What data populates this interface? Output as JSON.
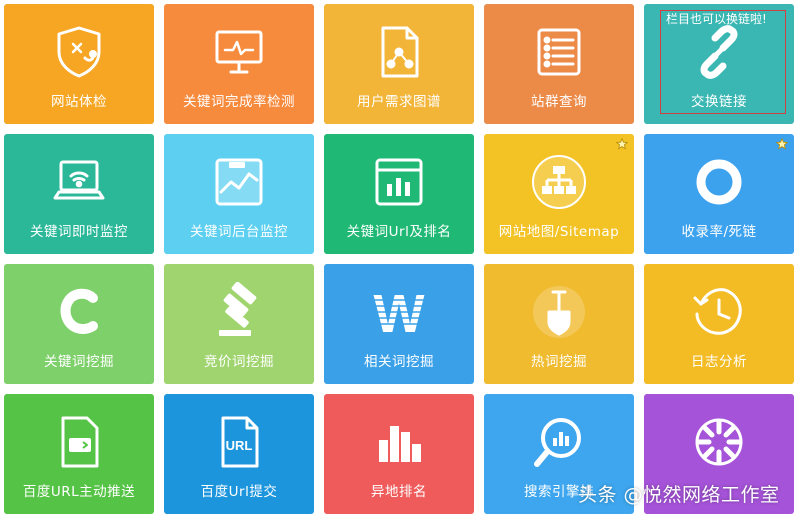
{
  "tiles": [
    {
      "label": "网站体检",
      "icon": "shield-stethoscope-icon",
      "color": "#f6a623"
    },
    {
      "label": "关键词完成率检测",
      "icon": "monitor-pulse-icon",
      "color": "#f68b3e"
    },
    {
      "label": "用户需求图谱",
      "icon": "document-graph-icon",
      "color": "#f2b538"
    },
    {
      "label": "站群查询",
      "icon": "list-icon",
      "color": "#ec8a48"
    },
    {
      "label": "交换链接",
      "icon": "chain-link-icon",
      "color": "#3ab7b3"
    },
    {
      "label": "关键词即时监控",
      "icon": "laptop-wifi-icon",
      "color": "#2bb899"
    },
    {
      "label": "关键词后台监控",
      "icon": "chart-trend-icon",
      "color": "#5dcff0"
    },
    {
      "label": "关键词Url及排名",
      "icon": "bar-chart-window-icon",
      "color": "#1fb874"
    },
    {
      "label": "网站地图/Sitemap",
      "icon": "sitemap-icon",
      "color": "#f3c224"
    },
    {
      "label": "收录率/死链",
      "icon": "ring-icon",
      "color": "#3ca2ee"
    },
    {
      "label": "关键词挖掘",
      "icon": "letter-c-icon",
      "color": "#7ed06a"
    },
    {
      "label": "竞价词挖掘",
      "icon": "gavel-icon",
      "color": "#9fd46e"
    },
    {
      "label": "相关词挖掘",
      "icon": "letter-w-icon",
      "color": "#3aa0e8"
    },
    {
      "label": "热词挖掘",
      "icon": "shovel-icon",
      "color": "#f0bb2f"
    },
    {
      "label": "日志分析",
      "icon": "clock-icon",
      "color": "#f3bb24"
    },
    {
      "label": "百度URL主动推送",
      "icon": "push-arrow-icon",
      "color": "#55c345"
    },
    {
      "label": "百度Url提交",
      "icon": "url-document-icon",
      "color": "#1d95dd"
    },
    {
      "label": "异地排名",
      "icon": "bars-icon",
      "color": "#ef5b5b"
    },
    {
      "label": "搜索引擎排",
      "icon": "search-chart-icon",
      "color": "#3da6ee"
    },
    {
      "label": "",
      "icon": "aperture-icon",
      "color": "#a553d8"
    }
  ],
  "note": "栏目也可以换链啦!",
  "watermark": "头条 @悦然网络工作室"
}
